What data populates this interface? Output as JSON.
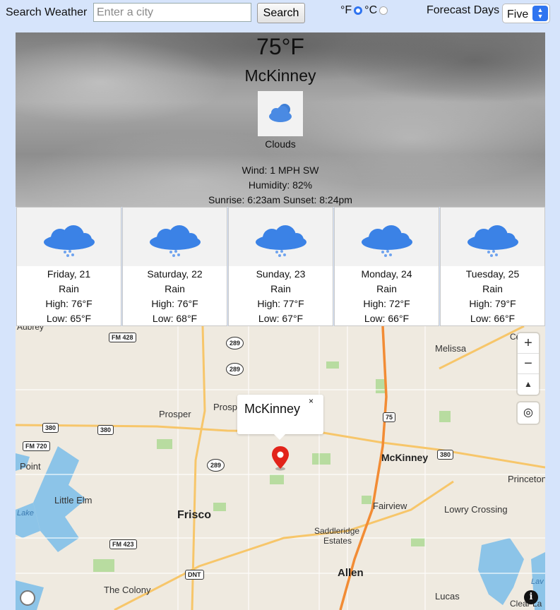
{
  "search": {
    "label": "Search Weather",
    "placeholder": "Enter a city",
    "button_label": "Search"
  },
  "units": {
    "fahrenheit_label": "°F",
    "celsius_label": "°C",
    "selected": "°F"
  },
  "forecast_select": {
    "label": "Forecast Days",
    "selected": "Five"
  },
  "current": {
    "temperature": "75°F",
    "city": "McKinney",
    "condition": "Clouds",
    "wind": "Wind: 1 MPH SW",
    "humidity": "Humidity: 82%",
    "sun": "Sunrise: 6:23am  Sunset: 8:24pm"
  },
  "forecast": [
    {
      "day": "Friday, 21",
      "condition": "Rain",
      "high": "High: 76°F",
      "low": "Low: 65°F"
    },
    {
      "day": "Saturday, 22",
      "condition": "Rain",
      "high": "High: 76°F",
      "low": "Low: 68°F"
    },
    {
      "day": "Sunday, 23",
      "condition": "Rain",
      "high": "High: 77°F",
      "low": "Low: 67°F"
    },
    {
      "day": "Monday, 24",
      "condition": "Rain",
      "high": "High: 72°F",
      "low": "Low: 66°F"
    },
    {
      "day": "Tuesday, 25",
      "condition": "Rain",
      "high": "High: 79°F",
      "low": "Low: 66°F"
    }
  ],
  "map": {
    "popup_title": "McKinney",
    "popup_close": "×",
    "zoom_in": "+",
    "zoom_out": "−",
    "compass": "▲",
    "info": "i",
    "places": {
      "aubrey": "Aubrey",
      "melissa": "Melissa",
      "celina": "Celina",
      "prosper": "Prosper",
      "prosp": "Prosp",
      "mckinney": "McKinney",
      "princeton": "Princeton",
      "lake_point": "Point",
      "little_elm": "Little Elm",
      "lake": "Lake",
      "frisco": "Frisco",
      "fairview": "Fairview",
      "lowry_crossing": "Lowry Crossing",
      "saddleridge": "Saddleridge",
      "estates": "Estates",
      "allen": "Allen",
      "the_colony": "The Colony",
      "lucas": "Lucas",
      "lav": "Lav",
      "clear_lake": "Clear La"
    },
    "shields": {
      "fm428": "FM 428",
      "s289a": "289",
      "s289b": "289",
      "s289c": "289",
      "s75": "75",
      "s380a": "380",
      "s380b": "380",
      "s380c": "380",
      "fm720": "FM 720",
      "fm423": "FM 423",
      "dnt": "DNT"
    }
  }
}
